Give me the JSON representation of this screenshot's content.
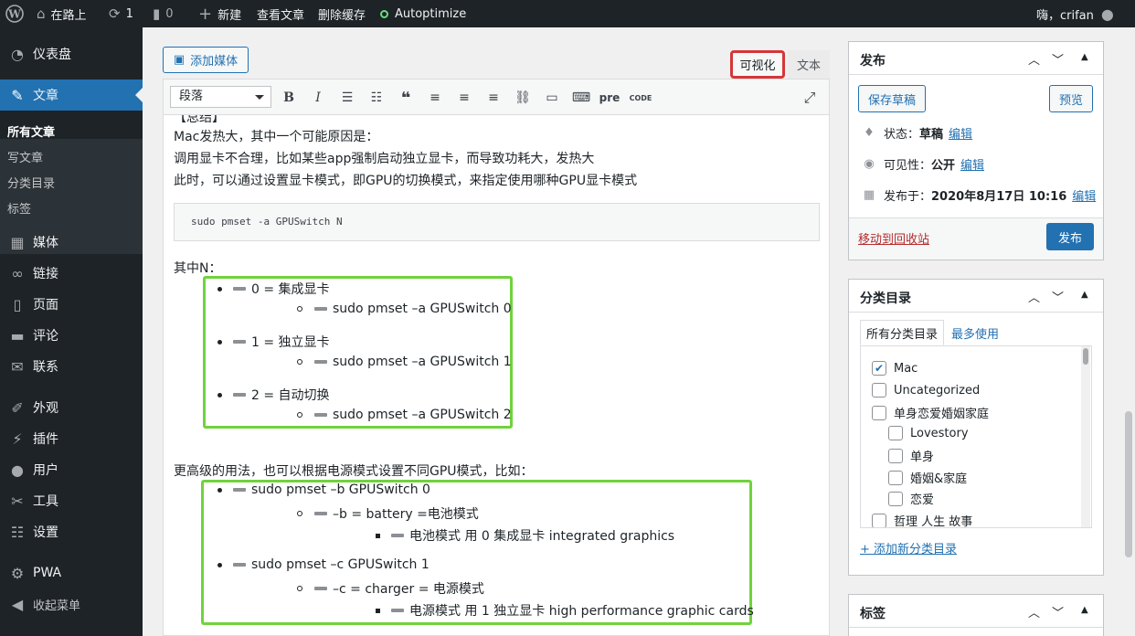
{
  "adminbar": {
    "site": "在路上",
    "updates": "1",
    "comments": "0",
    "new": "新建",
    "view": "查看文章",
    "purge": "删除缓存",
    "plugin": "Autoptimize",
    "greeting": "嗨，crifan"
  },
  "sidebar": {
    "dashboard": "仪表盘",
    "posts": "文章",
    "posts_sub": [
      "所有文章",
      "写文章",
      "分类目录",
      "标签"
    ],
    "media": "媒体",
    "links": "链接",
    "pages": "页面",
    "comments": "评论",
    "contact": "联系",
    "appearance": "外观",
    "plugins": "插件",
    "users": "用户",
    "tools": "工具",
    "settings": "设置",
    "pwa": "PWA",
    "collapse": "收起菜单"
  },
  "editor": {
    "add_media": "添加媒体",
    "tab_visual": "可视化",
    "tab_text": "文本",
    "format": "段落",
    "toolbar_pre": "pre",
    "toolbar_code": "CODE",
    "cut_line": "【总结】",
    "p1": "Mac发热大，其中一个可能原因是：",
    "p2": "调用显卡不合理，比如某些app强制启动独立显卡，而导致功耗大，发热大",
    "p3": "此时，可以通过设置显卡模式，即GPU的切换模式，来指定使用哪种GPU显卡模式",
    "code": "sudo pmset -a GPUSwitch N",
    "p4": "其中N：",
    "list1": [
      {
        "item": "0 = 集成显卡",
        "sub": "sudo pmset –a GPUSwitch 0"
      },
      {
        "item": "1 = 独立显卡",
        "sub": "sudo pmset –a GPUSwitch 1"
      },
      {
        "item": "2 = 自动切换",
        "sub": "sudo pmset –a GPUSwitch 2"
      }
    ],
    "p5": "更高级的用法，也可以根据电源模式设置不同GPU模式，比如：",
    "list2": [
      {
        "item": "sudo pmset –b GPUSwitch 0",
        "sub": "–b = battery =电池模式",
        "subsub": "电池模式 用 0 集成显卡 integrated graphics"
      },
      {
        "item": "sudo pmset –c GPUSwitch 1",
        "sub": "–c = charger = 电源模式",
        "subsub": "电源模式 用 1 独立显卡 high performance graphic cards"
      }
    ]
  },
  "publish": {
    "title": "发布",
    "save_draft": "保存草稿",
    "preview": "预览",
    "status_label": "状态：",
    "status_value": "草稿",
    "visibility_label": "可见性：",
    "visibility_value": "公开",
    "date_label": "发布于：",
    "date_value": "2020年8月17日 10:16",
    "edit": "编辑",
    "trash": "移动到回收站",
    "publish": "发布"
  },
  "categories": {
    "title": "分类目录",
    "tab_all": "所有分类目录",
    "tab_popular": "最多使用",
    "items": [
      {
        "label": "Mac",
        "checked": true
      },
      {
        "label": "Uncategorized",
        "checked": false
      },
      {
        "label": "单身恋爱婚姻家庭",
        "checked": false
      },
      {
        "label": "Lovestory",
        "checked": false
      },
      {
        "label": "单身",
        "checked": false
      },
      {
        "label": "婚姻&家庭",
        "checked": false
      },
      {
        "label": "恋爱",
        "checked": false
      },
      {
        "label": "哲理 人生 故事",
        "checked": false
      }
    ],
    "add_new": "+ 添加新分类目录"
  },
  "tags": {
    "title": "标签"
  },
  "colors": {
    "admin_bar": "#1d2327",
    "accent": "#2271b1",
    "highlight_red": "#d63638",
    "highlight_green": "#70d33c"
  }
}
